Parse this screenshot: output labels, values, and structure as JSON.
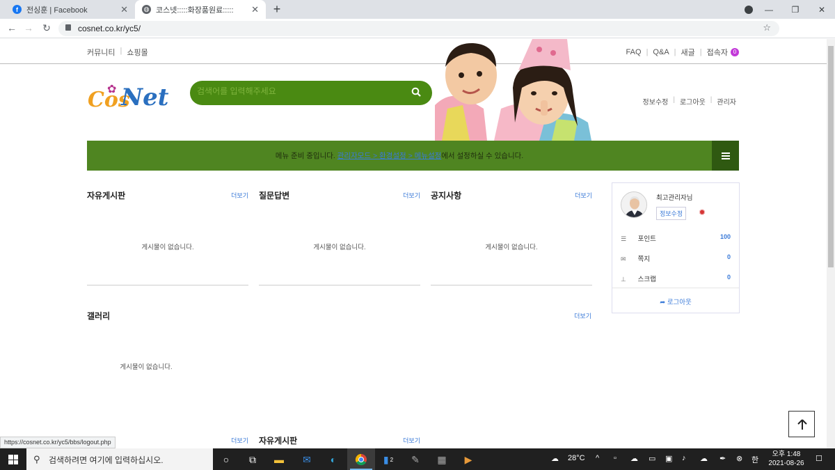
{
  "browser": {
    "tabs": [
      {
        "title": "전싱훈 | Facebook",
        "icon": "facebook-icon"
      },
      {
        "title": "코스넷:::::화장품원료:::::",
        "icon": "globe-icon"
      }
    ],
    "url": "cosnet.co.kr/yc5/"
  },
  "site": {
    "top_left": [
      "커뮤니티",
      "쇼핑몰"
    ],
    "top_right": [
      "FAQ",
      "Q&A",
      "새글",
      "접속자"
    ],
    "visitor_count": "0",
    "logo_text_1": "Cos",
    "logo_text_2": "Net",
    "search_placeholder": "검색어를 입력해주세요",
    "user_nav": [
      "정보수정",
      "로그아웃",
      "관리자"
    ],
    "menu_notice_pre": "메뉴 준비 중입니다. ",
    "menu_notice_link": "관리자모드 > 환경설정 > 메뉴설정",
    "menu_notice_post": "에서 설정하실 수 있습니다."
  },
  "boards": [
    {
      "title": "자유게시판",
      "more": "더보기",
      "empty": "게시물이 없습니다."
    },
    {
      "title": "질문답변",
      "more": "더보기",
      "empty": "게시물이 없습니다."
    },
    {
      "title": "공지사항",
      "more": "더보기",
      "empty": "게시물이 없습니다."
    }
  ],
  "gallery": {
    "title": "갤러리",
    "more": "더보기",
    "empty": "게시물이 없습니다."
  },
  "bottom_boards": [
    {
      "title": "",
      "more": "더보기"
    },
    {
      "title": "자유게시판",
      "more": "더보기"
    }
  ],
  "sidebar": {
    "name": "최고관리자님",
    "edit": "정보수정",
    "rows": [
      {
        "label": "포인트",
        "value": "100",
        "icon": "database-icon"
      },
      {
        "label": "쪽지",
        "value": "0",
        "icon": "mail-icon"
      },
      {
        "label": "스크랩",
        "value": "0",
        "icon": "pin-icon"
      }
    ],
    "logout": "로그아웃"
  },
  "status_url": "https://cosnet.co.kr/yc5/bbs/logout.php",
  "taskbar": {
    "search_placeholder": "검색하려면 여기에 입력하십시오.",
    "temperature": "28°C",
    "ime": "한",
    "time": "오후 1:48",
    "date": "2021-08-26",
    "badge": "2"
  },
  "colors": {
    "brand_green": "#4f8521",
    "search_green": "#4a8a12",
    "link_blue": "#3a7ad8"
  }
}
